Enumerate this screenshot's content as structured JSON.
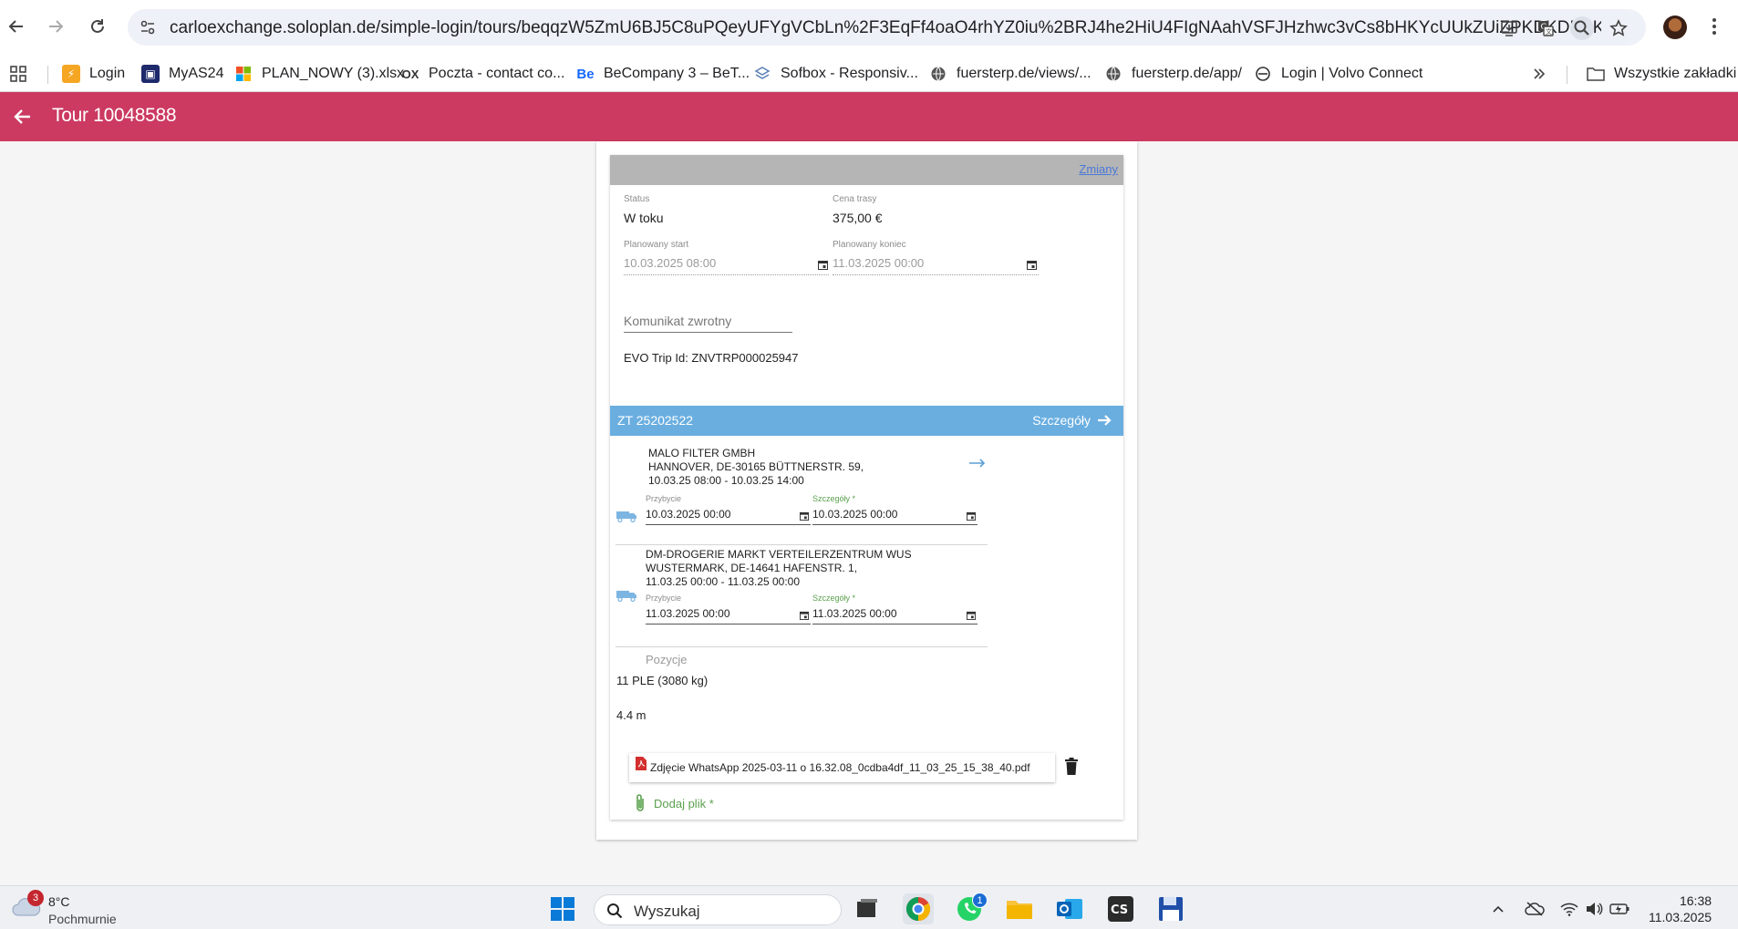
{
  "browser": {
    "url": "carloexchange.soloplan.de/simple-login/tours/beqqzW5ZmU6BJ5C8uPQeyUFYgVCbLn%2F3EqFf4oaO4rhYZ0iu%2BRJ4he2HiU4FIgNAahVSFJHzhwc3vCs8bHKYcUUkZUiZPKDKDEBKqXt1H..."
  },
  "bookmarks": {
    "items": [
      {
        "label": "Login",
        "color": "#f5a623"
      },
      {
        "label": "MyAS24",
        "color": "#1e2a6b"
      },
      {
        "label": "PLAN_NOWY (3).xlsx",
        "color": "#ef4a23"
      },
      {
        "label": "Poczta - contact co...",
        "color": "#333333"
      },
      {
        "label": "BeCompany 3 – BeT...",
        "color": "#1769ff"
      },
      {
        "label": "Sofbox - Responsiv...",
        "color": "#5a7fb5"
      },
      {
        "label": "fuersterp.de/views/...",
        "color": "#555555"
      },
      {
        "label": "fuersterp.de/app/",
        "color": "#555555"
      },
      {
        "label": "Login | Volvo Connect",
        "color": "#333333"
      }
    ],
    "all_bookmarks": "Wszystkie zakładki"
  },
  "app": {
    "title": "Tour 10048588"
  },
  "tour": {
    "changes_link": "Zmiany",
    "status_label": "Status",
    "status_value": "W toku",
    "price_label": "Cena trasy",
    "price_value": "375,00 €",
    "planned_start_label": "Planowany start",
    "planned_start_value": "10.03.2025 08:00",
    "planned_end_label": "Planowany koniec",
    "planned_end_value": "11.03.2025 00:00",
    "feedback_placeholder": "Komunikat zwrotny",
    "evo_trip": "EVO Trip Id: ZNVTRP000025947"
  },
  "order": {
    "title": "ZT 25202522",
    "details_label": "Szczegóły",
    "stops": [
      {
        "name": "MALO FILTER GMBH",
        "address": "HANNOVER, DE-30165 BÜTTNERSTR. 59,",
        "window": "10.03.25 08:00 - 10.03.25 14:00",
        "arrival_label": "Przybycie",
        "arrival_value": "10.03.2025 00:00",
        "details_label": "Szczegóły *",
        "details_value": "10.03.2025 00:00"
      },
      {
        "name": "DM-DROGERIE MARKT VERTEILERZENTRUM WUS",
        "address": "WUSTERMARK, DE-14641 HAFENSTR. 1,",
        "window": "11.03.25 00:00 - 11.03.25 00:00",
        "arrival_label": "Przybycie",
        "arrival_value": "11.03.2025 00:00",
        "details_label": "Szczegóły *",
        "details_value": "11.03.2025 00:00"
      }
    ],
    "positions_label": "Pozycje",
    "positions_value": "11 PLE (3080 kg)",
    "length_value": "4.4 m",
    "file_name": "Zdjęcie WhatsApp 2025-03-11 o 16.32.08_0cdba4df_11_03_25_15_38_40.pdf",
    "add_file_label": "Dodaj plik *"
  },
  "taskbar": {
    "weather_badge": "3",
    "weather_temp": "8°C",
    "weather_desc": "Pochmurnie",
    "search_placeholder": "Wyszukaj",
    "whatsapp_badge": "1",
    "time": "16:38",
    "date": "11.03.2025"
  },
  "colors": {
    "header": "#cc3a61",
    "order_bar": "#6aaee0",
    "accent_green": "#5aa14d"
  }
}
